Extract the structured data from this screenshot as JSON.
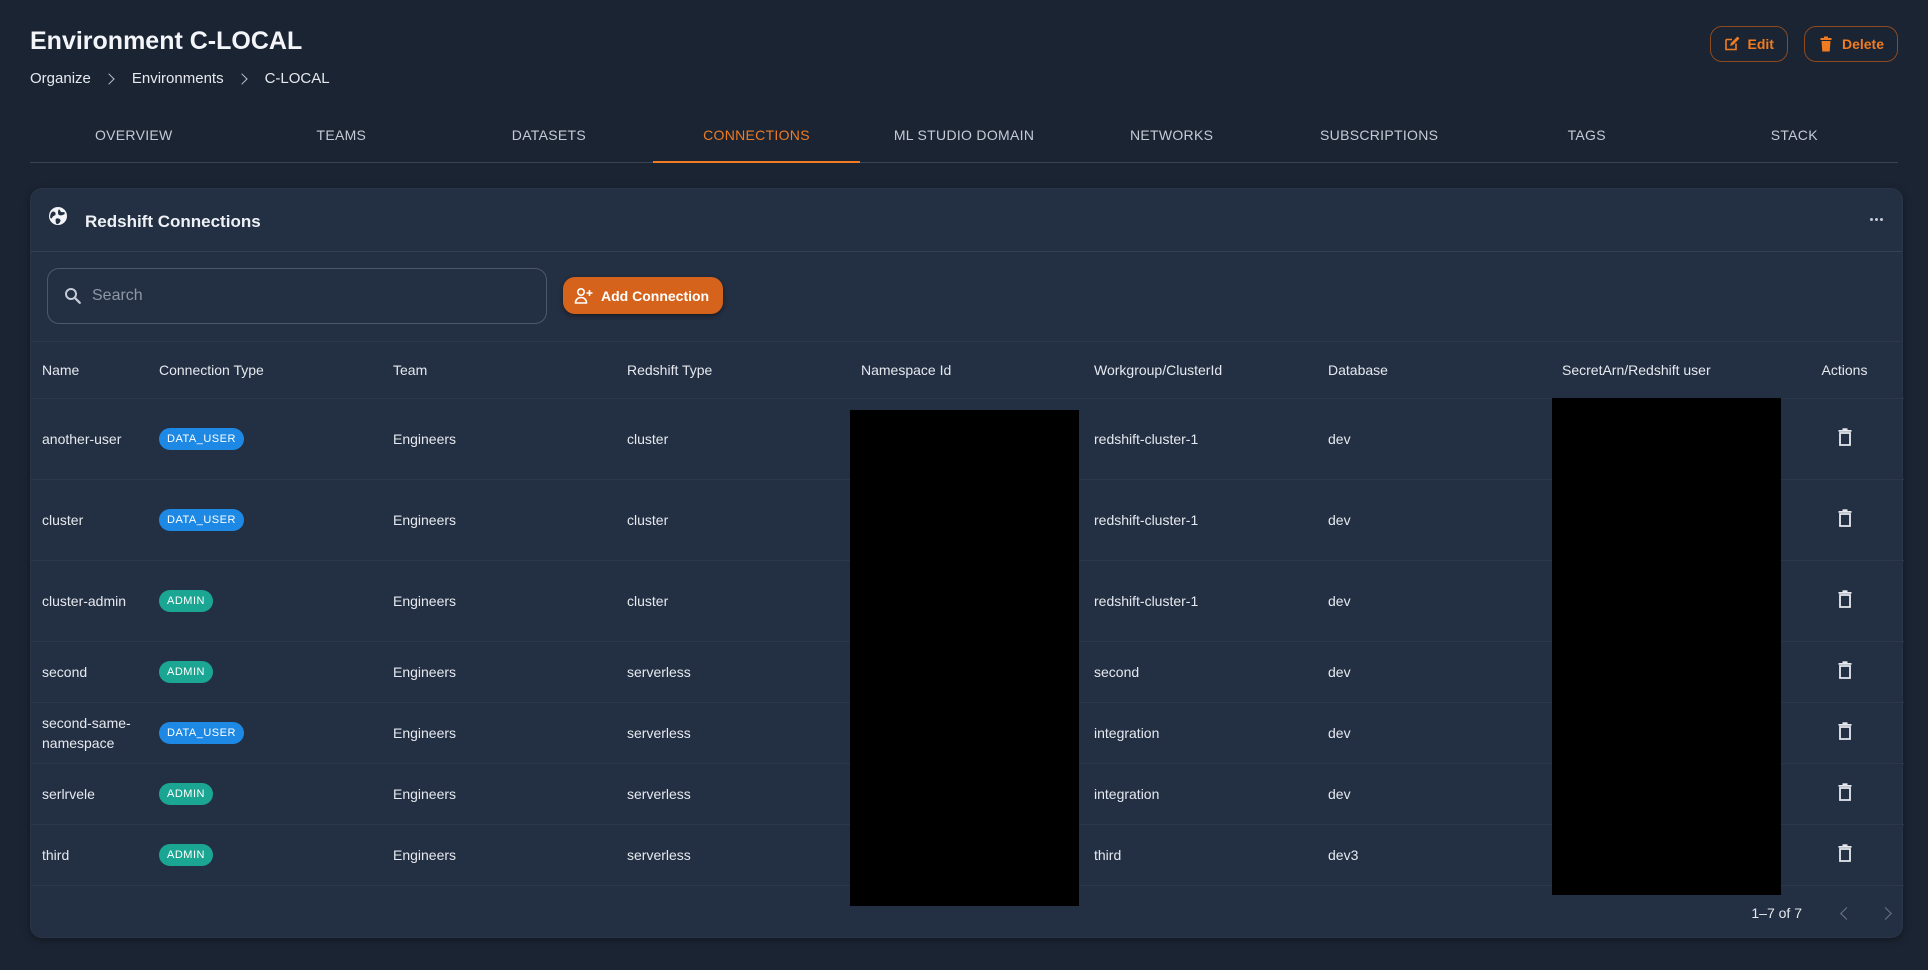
{
  "header": {
    "title": "Environment C-LOCAL",
    "breadcrumb": [
      "Organize",
      "Environments",
      "C-LOCAL"
    ],
    "edit_label": "Edit",
    "delete_label": "Delete"
  },
  "tabs": [
    {
      "label": "OVERVIEW",
      "active": false
    },
    {
      "label": "TEAMS",
      "active": false
    },
    {
      "label": "DATASETS",
      "active": false
    },
    {
      "label": "CONNECTIONS",
      "active": true
    },
    {
      "label": "ML STUDIO DOMAIN",
      "active": false
    },
    {
      "label": "NETWORKS",
      "active": false
    },
    {
      "label": "SUBSCRIPTIONS",
      "active": false
    },
    {
      "label": "TAGS",
      "active": false
    },
    {
      "label": "STACK",
      "active": false
    }
  ],
  "card": {
    "title": "Redshift Connections",
    "search_placeholder": "Search",
    "add_label": "Add Connection"
  },
  "table": {
    "columns": [
      "Name",
      "Connection Type",
      "Team",
      "Redshift Type",
      "Namespace Id",
      "Workgroup/ClusterId",
      "Database",
      "SecretArn/Redshift user",
      "Actions"
    ],
    "rows": [
      {
        "name": "another-user",
        "type": "DATA_USER",
        "team": "Engineers",
        "redshift_type": "cluster",
        "workgroup": "redshift-cluster-1",
        "database": "dev"
      },
      {
        "name": "cluster",
        "type": "DATA_USER",
        "team": "Engineers",
        "redshift_type": "cluster",
        "workgroup": "redshift-cluster-1",
        "database": "dev"
      },
      {
        "name": "cluster-admin",
        "type": "ADMIN",
        "team": "Engineers",
        "redshift_type": "cluster",
        "workgroup": "redshift-cluster-1",
        "database": "dev"
      },
      {
        "name": "second",
        "type": "ADMIN",
        "team": "Engineers",
        "redshift_type": "serverless",
        "workgroup": "second",
        "database": "dev"
      },
      {
        "name": "second-same-namespace",
        "type": "DATA_USER",
        "team": "Engineers",
        "redshift_type": "serverless",
        "workgroup": "integration",
        "database": "dev"
      },
      {
        "name": "serlrvele",
        "type": "ADMIN",
        "team": "Engineers",
        "redshift_type": "serverless",
        "workgroup": "integration",
        "database": "dev"
      },
      {
        "name": "third",
        "type": "ADMIN",
        "team": "Engineers",
        "redshift_type": "serverless",
        "workgroup": "third",
        "database": "dev3"
      }
    ]
  },
  "pagination": {
    "range": "1–7 of 7"
  },
  "colors": {
    "accent": "#f07b20",
    "data_user_chip": "#1e88e5",
    "admin_chip": "#1aa692",
    "background": "#1b2433",
    "card": "#232f42"
  }
}
